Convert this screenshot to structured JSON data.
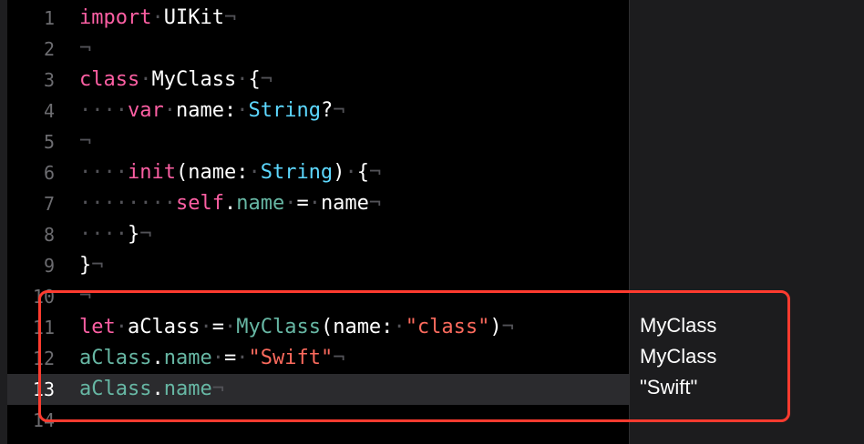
{
  "editor": {
    "lines": [
      {
        "number": "1",
        "tokens": [
          [
            "kw",
            "import"
          ],
          [
            "ws",
            "·"
          ],
          [
            "plain",
            "UIKit"
          ],
          [
            "eol",
            "¬"
          ]
        ]
      },
      {
        "number": "2",
        "tokens": [
          [
            "eol",
            "¬"
          ]
        ]
      },
      {
        "number": "3",
        "tokens": [
          [
            "kw",
            "class"
          ],
          [
            "ws",
            "·"
          ],
          [
            "plain",
            "MyClass"
          ],
          [
            "ws",
            "·"
          ],
          [
            "plain",
            "{"
          ],
          [
            "eol",
            "¬"
          ]
        ]
      },
      {
        "number": "4",
        "tokens": [
          [
            "ws",
            "····"
          ],
          [
            "kw",
            "var"
          ],
          [
            "ws",
            "·"
          ],
          [
            "plain",
            "name:"
          ],
          [
            "ws",
            "·"
          ],
          [
            "type",
            "String"
          ],
          [
            "plain",
            "?"
          ],
          [
            "eol",
            "¬"
          ]
        ]
      },
      {
        "number": "5",
        "tokens": [
          [
            "eol",
            "¬"
          ]
        ]
      },
      {
        "number": "6",
        "tokens": [
          [
            "ws",
            "····"
          ],
          [
            "kw",
            "init"
          ],
          [
            "plain",
            "(name:"
          ],
          [
            "ws",
            "·"
          ],
          [
            "type",
            "String"
          ],
          [
            "plain",
            ")"
          ],
          [
            "ws",
            "·"
          ],
          [
            "plain",
            "{"
          ],
          [
            "eol",
            "¬"
          ]
        ]
      },
      {
        "number": "7",
        "tokens": [
          [
            "ws",
            "········"
          ],
          [
            "kw",
            "self"
          ],
          [
            "plain",
            "."
          ],
          [
            "proj",
            "name"
          ],
          [
            "ws",
            "·"
          ],
          [
            "plain",
            "="
          ],
          [
            "ws",
            "·"
          ],
          [
            "plain",
            "name"
          ],
          [
            "eol",
            "¬"
          ]
        ]
      },
      {
        "number": "8",
        "tokens": [
          [
            "ws",
            "····"
          ],
          [
            "plain",
            "}"
          ],
          [
            "eol",
            "¬"
          ]
        ]
      },
      {
        "number": "9",
        "tokens": [
          [
            "plain",
            "}"
          ],
          [
            "eol",
            "¬"
          ]
        ]
      },
      {
        "number": "10",
        "tokens": [
          [
            "eol",
            "¬"
          ]
        ]
      },
      {
        "number": "11",
        "tokens": [
          [
            "kw",
            "let"
          ],
          [
            "ws",
            "·"
          ],
          [
            "plain",
            "aClass"
          ],
          [
            "ws",
            "·"
          ],
          [
            "plain",
            "="
          ],
          [
            "ws",
            "·"
          ],
          [
            "proj",
            "MyClass"
          ],
          [
            "plain",
            "(name:"
          ],
          [
            "ws",
            "·"
          ],
          [
            "str",
            "\"class\""
          ],
          [
            "plain",
            ")"
          ],
          [
            "eol",
            "¬"
          ]
        ]
      },
      {
        "number": "12",
        "tokens": [
          [
            "proj",
            "aClass"
          ],
          [
            "plain",
            "."
          ],
          [
            "proj",
            "name"
          ],
          [
            "ws",
            "·"
          ],
          [
            "plain",
            "="
          ],
          [
            "ws",
            "·"
          ],
          [
            "str",
            "\"Swift\""
          ],
          [
            "eol",
            "¬"
          ]
        ]
      },
      {
        "number": "13",
        "tokens": [
          [
            "proj",
            "aClass"
          ],
          [
            "plain",
            "."
          ],
          [
            "proj",
            "name"
          ],
          [
            "eol",
            "¬"
          ]
        ],
        "current": true
      },
      {
        "number": "14",
        "tokens": []
      }
    ]
  },
  "results": {
    "line11": "MyClass",
    "line12": "MyClass",
    "line13": "\"Swift\""
  },
  "colors": {
    "keyword": "#fc5fa3",
    "type": "#5dd8ff",
    "project_symbol": "#67b7a4",
    "string": "#fc6a5d",
    "invisible": "#525257",
    "highlight_box": "#ff3b2f",
    "current_line": "#2b2b2e"
  }
}
